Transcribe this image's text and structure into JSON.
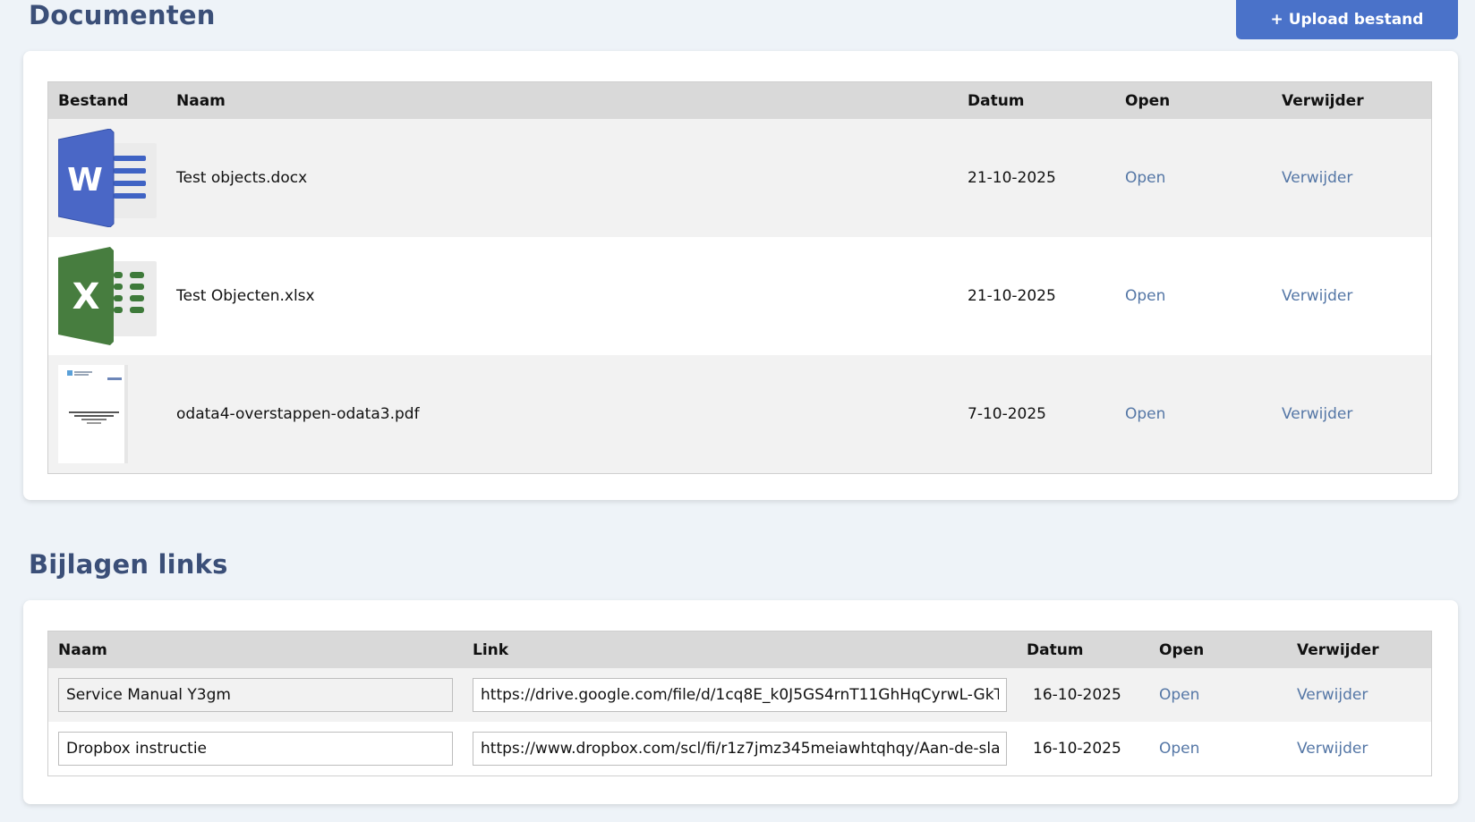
{
  "documents": {
    "title": "Documenten",
    "upload_label": "+ Upload bestand",
    "columns": [
      "Bestand",
      "Naam",
      "Datum",
      "Open",
      "Verwijder"
    ],
    "rows": [
      {
        "icon": "word-file-icon",
        "name": "Test objects.docx",
        "date": "21-10-2025",
        "open": "Open",
        "delete": "Verwijder"
      },
      {
        "icon": "excel-file-icon",
        "name": "Test Objecten.xlsx",
        "date": "21-10-2025",
        "open": "Open",
        "delete": "Verwijder"
      },
      {
        "icon": "pdf-thumbnail",
        "name": "odata4-overstappen-odata3.pdf",
        "date": "7-10-2025",
        "open": "Open",
        "delete": "Verwijder"
      }
    ]
  },
  "links": {
    "title": "Bijlagen links",
    "columns": [
      "Naam",
      "Link",
      "Datum",
      "Open",
      "Verwijder"
    ],
    "rows": [
      {
        "name": "Service Manual Y3gm",
        "url": "https://drive.google.com/file/d/1cq8E_k0J5GS4rnT11GhHqCyrwL-GkT",
        "date": "16-10-2025",
        "open": "Open",
        "delete": "Verwijder"
      },
      {
        "name": "Dropbox instructie",
        "url": "https://www.dropbox.com/scl/fi/r1z7jmz345meiawhtqhqy/Aan-de-sla",
        "date": "16-10-2025",
        "open": "Open",
        "delete": "Verwijder"
      }
    ]
  },
  "colors": {
    "title": "#3b4f78",
    "accent": "#4a72c9",
    "link": "#5577a6",
    "word": "#3f63c4",
    "excel": "#3e7a3a"
  }
}
